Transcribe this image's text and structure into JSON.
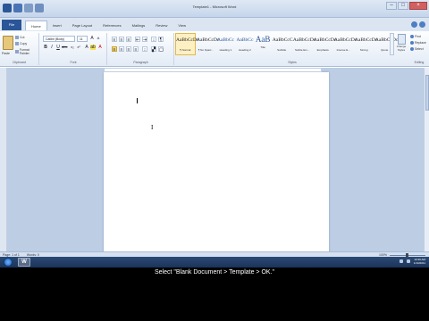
{
  "window": {
    "title": "Template1 - Microsoft Word",
    "controls": [
      "–",
      "□",
      "×"
    ]
  },
  "quick_access": [
    "word-icon",
    "save-icon",
    "undo-icon",
    "redo-icon"
  ],
  "ribbon": {
    "file_tab": "File",
    "tabs": [
      "Home",
      "Insert",
      "Page Layout",
      "References",
      "Mailings",
      "Review",
      "View"
    ],
    "active_tab": "Home",
    "clipboard": {
      "label": "Clipboard",
      "paste": "Paste",
      "items": [
        "Cut",
        "Copy",
        "Format Painter"
      ]
    },
    "font": {
      "label": "Font",
      "name": "Calibri (Body)",
      "size": "11"
    },
    "paragraph": {
      "label": "Paragraph"
    },
    "styles": {
      "label": "Styles",
      "items": [
        {
          "sample": "AaBbCcDc",
          "name": "¶ Normal",
          "kind": "normal",
          "selected": true
        },
        {
          "sample": "AaBbCcDc",
          "name": "¶ No Spaci...",
          "kind": "normal"
        },
        {
          "sample": "AaBbCc",
          "name": "Heading 1",
          "kind": "head"
        },
        {
          "sample": "AaBbCc",
          "name": "Heading 2",
          "kind": "head"
        },
        {
          "sample": "AaB",
          "name": "Title",
          "kind": "big"
        },
        {
          "sample": "AaBbCcC",
          "name": "Subtitle",
          "kind": "normal"
        },
        {
          "sample": "AaBbCcDc",
          "name": "Subtle Em...",
          "kind": "normal"
        },
        {
          "sample": "AaBbCcDc",
          "name": "Emphasis",
          "kind": "normal"
        },
        {
          "sample": "AaBbCcDc",
          "name": "Intense E...",
          "kind": "normal"
        },
        {
          "sample": "AaBbCcDc",
          "name": "Strong",
          "kind": "normal"
        },
        {
          "sample": "AaBbCcDc",
          "name": "Quote",
          "kind": "normal"
        }
      ],
      "change_styles": "Change Styles"
    },
    "editing": {
      "label": "Editing",
      "items": [
        "Find",
        "Replace",
        "Select"
      ]
    }
  },
  "statusbar": {
    "page": "Page: 1 of 1",
    "words": "Words: 0",
    "zoom": "100%"
  },
  "taskbar": {
    "word_button": "W",
    "time": "10:39 AM",
    "date": "1/10/2011"
  },
  "caption": "Select \"Blank Document > Template > OK.\""
}
